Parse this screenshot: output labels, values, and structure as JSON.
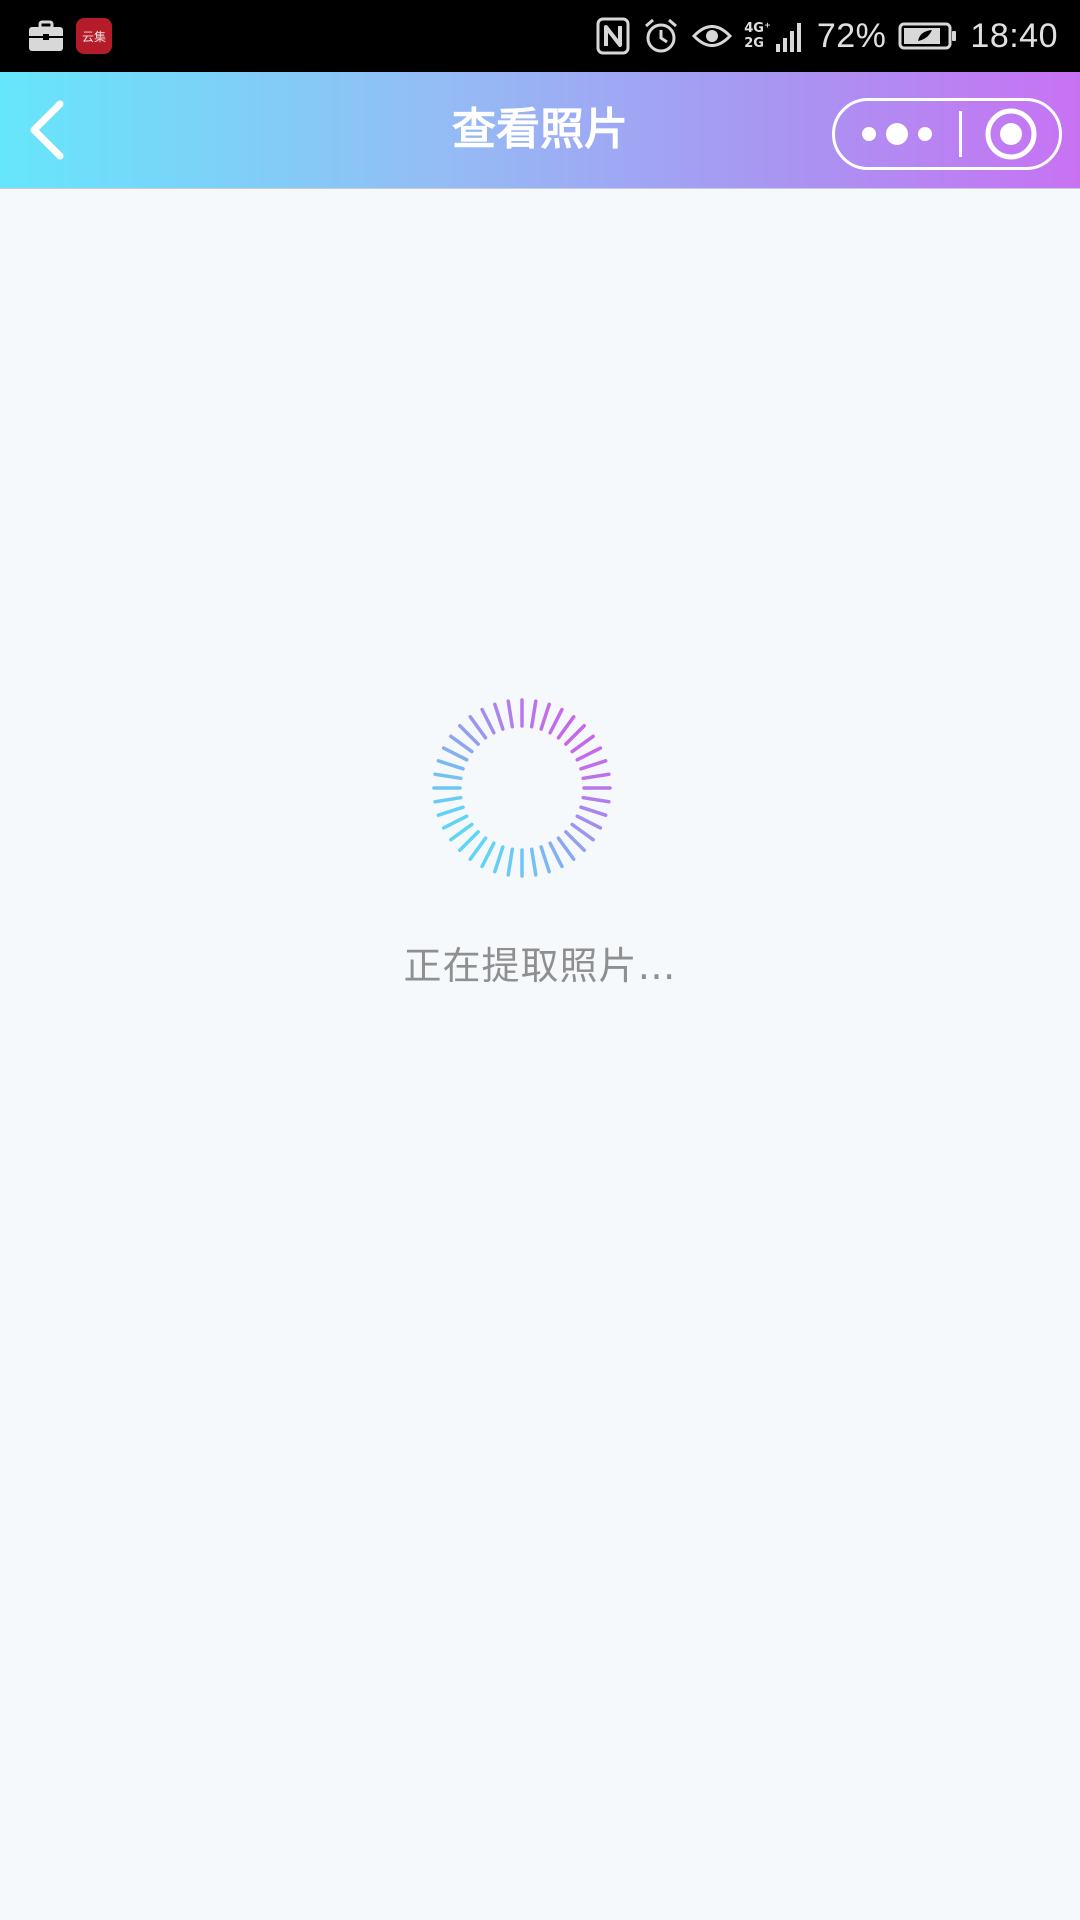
{
  "status_bar": {
    "left_icons": [
      "briefcase-icon",
      "app-icon"
    ],
    "app_icon_text": "云集",
    "nfc_icon": "nfc-icon",
    "alarm_icon": "alarm-icon",
    "eye_icon": "eye-comfort-icon",
    "network_top": "4G⁺",
    "network_bottom": "2G",
    "battery_percent": "72%",
    "time": "18:40"
  },
  "header": {
    "title": "查看照片",
    "back_icon": "chevron-left-icon",
    "more_icon": "more-dots-icon",
    "close_icon": "target-close-icon"
  },
  "loading": {
    "text": "正在提取照片…",
    "gradient_start": "#5fd6f5",
    "gradient_end": "#c767ec"
  },
  "colors": {
    "header_gradient": [
      "#66e6fb",
      "#93bdf5",
      "#ab92f2",
      "#c872f3"
    ],
    "background": "#f6f9fc"
  }
}
